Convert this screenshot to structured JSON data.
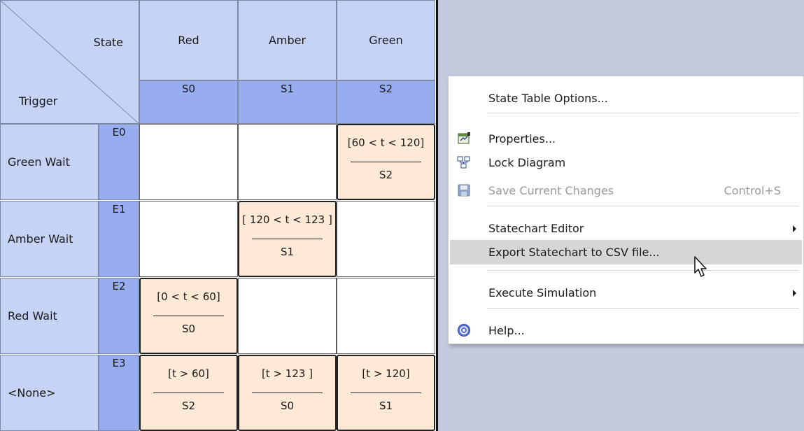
{
  "table": {
    "corner": {
      "state_label": "State",
      "trigger_label": "Trigger"
    },
    "states": [
      {
        "name": "Red",
        "code": "S0"
      },
      {
        "name": "Amber",
        "code": "S1"
      },
      {
        "name": "Green",
        "code": "S2"
      }
    ],
    "triggers": [
      {
        "name": "Green Wait",
        "code": "E0"
      },
      {
        "name": "Amber Wait",
        "code": "E1"
      },
      {
        "name": "Red Wait",
        "code": "E2"
      },
      {
        "name": "<None>",
        "code": "E3"
      }
    ],
    "cells": [
      [
        null,
        null,
        {
          "guard": "[60 < t < 120]",
          "target": "S2"
        }
      ],
      [
        null,
        {
          "guard": "[ 120 < t < 123 ]",
          "target": "S1"
        },
        null
      ],
      [
        {
          "guard": "[0 < t < 60]",
          "target": "S0"
        },
        null,
        null
      ],
      [
        {
          "guard": "[t > 60]",
          "target": "S2"
        },
        {
          "guard": "[t > 123 ]",
          "target": "S0"
        },
        {
          "guard": "[t  > 120]",
          "target": "S1"
        }
      ]
    ]
  },
  "context_menu": {
    "items": [
      {
        "label": "State Table Options...",
        "icon": "",
        "shortcut": "",
        "submenu": false,
        "disabled": false,
        "highlighted": false
      },
      {
        "label": "Properties...",
        "icon": "properties-icon",
        "shortcut": "",
        "submenu": false,
        "disabled": false,
        "highlighted": false
      },
      {
        "label": "Lock Diagram",
        "icon": "lock-diagram-icon",
        "shortcut": "",
        "submenu": false,
        "disabled": false,
        "highlighted": false
      },
      {
        "label": "Save Current Changes",
        "icon": "save-icon",
        "shortcut": "Control+S",
        "submenu": false,
        "disabled": true,
        "highlighted": false
      },
      {
        "label": "Statechart Editor",
        "icon": "",
        "shortcut": "",
        "submenu": true,
        "disabled": false,
        "highlighted": false
      },
      {
        "label": "Export Statechart to CSV file...",
        "icon": "",
        "shortcut": "",
        "submenu": false,
        "disabled": false,
        "highlighted": true
      },
      {
        "label": "Execute Simulation",
        "icon": "",
        "shortcut": "",
        "submenu": true,
        "disabled": false,
        "highlighted": false
      },
      {
        "label": "Help...",
        "icon": "help-icon",
        "shortcut": "",
        "submenu": false,
        "disabled": false,
        "highlighted": false
      }
    ]
  },
  "colors": {
    "header_bg": "#c6d3f5",
    "code_bg": "#97adf0",
    "transition_bg": "#fde9d6",
    "canvas_bg": "#c4c9dd",
    "menu_highlight": "#d6d6d6"
  }
}
